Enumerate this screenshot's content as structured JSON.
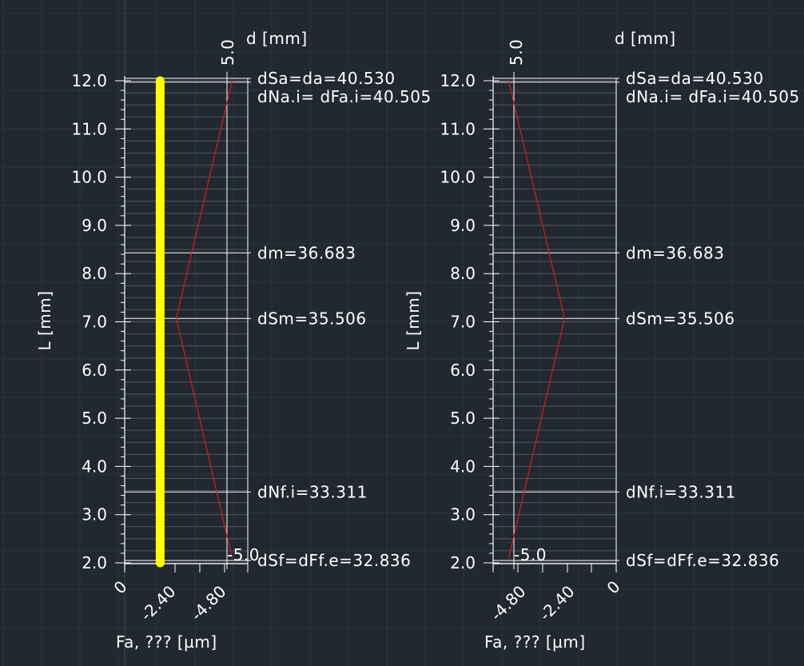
{
  "chart_data": [
    {
      "type": "line",
      "title": "",
      "xlabel": "Fa, ??? [µm]",
      "ylabel": "L [mm]",
      "top_label": "d [mm]",
      "xlim": [
        0,
        -5.0
      ],
      "ylim": [
        2.0,
        12.0
      ],
      "x_ticks": [
        "0",
        "-2.40",
        "-4.80"
      ],
      "y_ticks": [
        "2.0",
        "3.0",
        "4.0",
        "5.0",
        "6.0",
        "7.0",
        "8.0",
        "9.0",
        "10.0",
        "11.0",
        "12.0"
      ],
      "tolerance_top_label": "5.0",
      "tolerance_bottom_label": "-5.0",
      "series": [
        {
          "x": [
            -5.0,
            -2.4,
            -5.0
          ],
          "y": [
            12.0,
            7.07,
            2.1
          ],
          "color": "#cc1f1f"
        }
      ],
      "highlight": {
        "x": -1.65,
        "y": [
          2.0,
          12.0
        ],
        "color": "#ffff00"
      },
      "diameter_lines": [
        {
          "y": 12.05,
          "label": "dSa=da=40.530"
        },
        {
          "y": 11.97,
          "label": "dNa.i=  dFa.i=40.505"
        },
        {
          "y": 8.43,
          "label": "dm=36.683"
        },
        {
          "y": 7.07,
          "label": "dSm=35.506"
        },
        {
          "y": 3.47,
          "label": "dNf.i=33.311"
        },
        {
          "y": 2.05,
          "label": "dSf=dFf.e=32.836"
        }
      ]
    },
    {
      "type": "line",
      "title": "",
      "xlabel": "Fa, ??? [µm]",
      "ylabel": "L [mm]",
      "top_label": "d [mm]",
      "xlim": [
        -5.0,
        0
      ],
      "ylim": [
        2.0,
        12.0
      ],
      "x_ticks": [
        "-4.80",
        "-2.40",
        "0"
      ],
      "y_ticks": [
        "2.0",
        "3.0",
        "4.0",
        "5.0",
        "6.0",
        "7.0",
        "8.0",
        "9.0",
        "10.0",
        "11.0",
        "12.0"
      ],
      "tolerance_top_label": "5.0",
      "tolerance_bottom_label": "-5.0",
      "series": [
        {
          "x": [
            -5.0,
            -2.4,
            -5.0
          ],
          "y": [
            12.0,
            7.07,
            2.1
          ],
          "color": "#cc1f1f"
        }
      ],
      "diameter_lines": [
        {
          "y": 12.05,
          "label": "dSa=da=40.530"
        },
        {
          "y": 11.97,
          "label": "dNa.i=  dFa.i=40.505"
        },
        {
          "y": 8.43,
          "label": "dm=36.683"
        },
        {
          "y": 7.07,
          "label": "dSm=35.506"
        },
        {
          "y": 3.47,
          "label": "dNf.i=33.311"
        },
        {
          "y": 2.05,
          "label": "dSf=dFf.e=32.836"
        }
      ]
    }
  ]
}
